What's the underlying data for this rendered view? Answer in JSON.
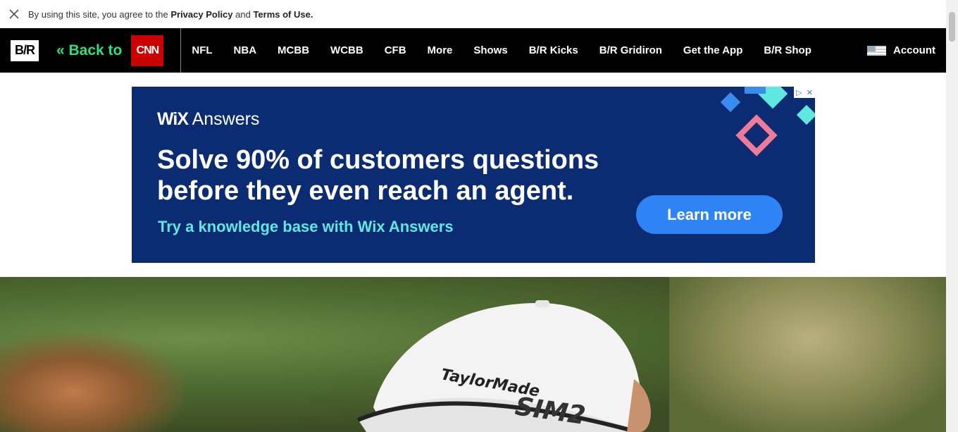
{
  "cookie_bar": {
    "text_prefix": "By using this site, you agree to the ",
    "privacy_link": "Privacy Policy",
    "text_and": " and ",
    "terms_link": "Terms of Use."
  },
  "nav": {
    "logo": "B/R",
    "back_label": "« Back to",
    "cnn_logo": "CNN",
    "items": [
      {
        "label": "NFL"
      },
      {
        "label": "NBA"
      },
      {
        "label": "MCBB"
      },
      {
        "label": "WCBB"
      },
      {
        "label": "CFB"
      },
      {
        "label": "More"
      },
      {
        "label": "Shows"
      },
      {
        "label": "B/R Kicks"
      },
      {
        "label": "B/R Gridiron"
      },
      {
        "label": "Get the App"
      },
      {
        "label": "B/R Shop"
      }
    ],
    "account_label": "Account"
  },
  "ad": {
    "brand_bold": "WiX",
    "brand_rest": " Answers",
    "headline": "Solve 90% of customers questions before they even reach an agent.",
    "subline": "Try a knowledge base with Wix Answers",
    "cta": "Learn more",
    "colors": {
      "background": "#0b2b73",
      "cta": "#2f84f5",
      "subline": "#5ee8e0"
    }
  },
  "hero": {
    "cap_logo": "TaylorMade",
    "cap_text": "SIM2"
  },
  "colors": {
    "nav_bg": "#000000",
    "back_green": "#2ee07a",
    "cnn_red": "#cc0000"
  }
}
